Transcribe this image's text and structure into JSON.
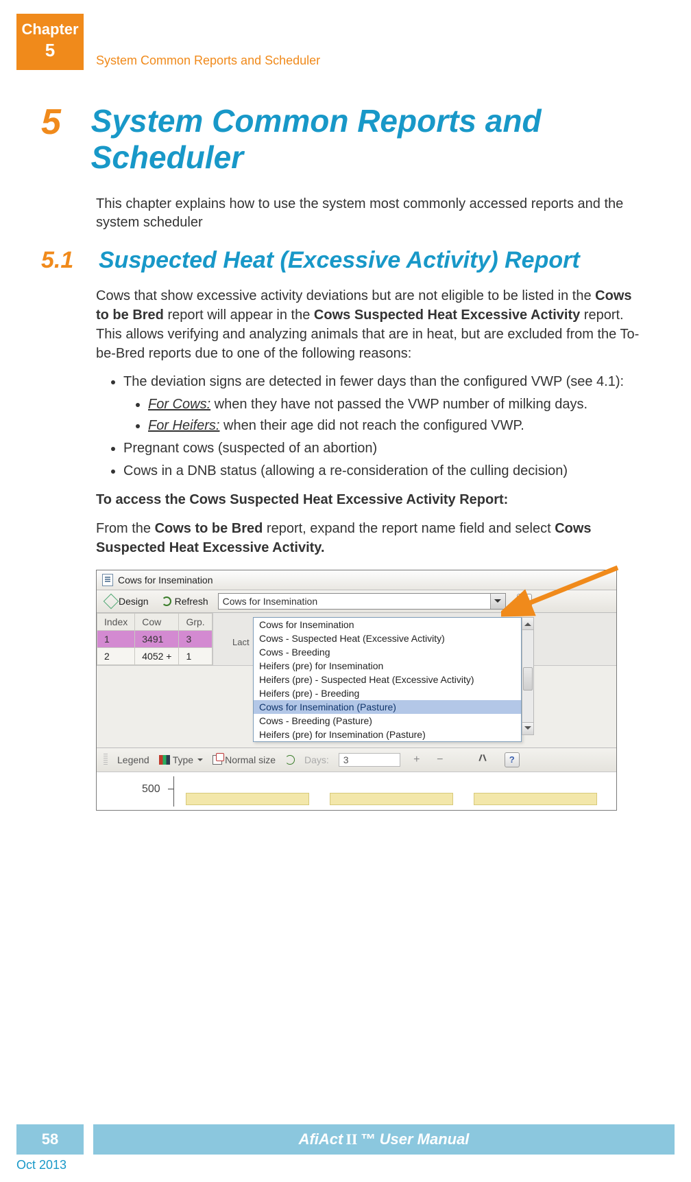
{
  "chapter_tab": {
    "word": "Chapter",
    "number": "5"
  },
  "running_head": "System Common Reports and Scheduler",
  "h1": {
    "num": "5",
    "title": "System Common Reports and Scheduler"
  },
  "intro": "This chapter explains how to use the system most commonly accessed reports and the system scheduler",
  "h2": {
    "num": "5.1",
    "title": "Suspected Heat (Excessive Activity) Report"
  },
  "para1_a": "Cows that show excessive activity deviations but are not eligible to be listed in the ",
  "para1_b": "Cows to be Bred",
  "para1_c": " report will appear in the ",
  "para1_d": "Cows Suspected Heat Excessive Activity",
  "para1_e": " report. This allows verifying and analyzing animals that are in heat, but are excluded from the To-be-Bred reports due to one of the following reasons:",
  "bullets": {
    "b1": "The deviation signs are detected in fewer days than the configured VWP (see 4.1):",
    "b1s1_lbl": "For Cows:",
    "b1s1_txt": " when they have not passed the VWP number of milking days.",
    "b1s2_lbl": "For Heifers:",
    "b1s2_txt": " when their age did not reach the configured VWP.",
    "b2": "Pregnant cows (suspected of an abortion)",
    "b3": "Cows in a DNB status (allowing a re-consideration of the culling decision)"
  },
  "access_head": "To access the Cows Suspected Heat Excessive Activity Report:",
  "access_a": "From the ",
  "access_b": "Cows to be Bred",
  "access_c": " report, expand the report name field and select ",
  "access_d": "Cows Suspected Heat Excessive Activity.",
  "app": {
    "window_title": "Cows for Insemination",
    "toolbar": {
      "design": "Design",
      "refresh": "Refresh",
      "help": "?"
    },
    "dropdown_selected": "Cows for Insemination",
    "dropdown_options": [
      "Cows for Insemination",
      "Cows - Suspected Heat (Excessive Activity)",
      "Cows - Breeding",
      "Heifers (pre) for Insemination",
      "Heifers (pre) - Suspected Heat (Excessive Activity)",
      "Heifers (pre) - Breeding",
      "Cows for Insemination (Pasture)",
      "Cows - Breeding (Pasture)",
      "Heifers (pre) for Insemination (Pasture)"
    ],
    "dropdown_selected_index": 6,
    "columns": {
      "c0": "Index",
      "c1": "Cow",
      "c2": "Grp.",
      "c3": "Lact"
    },
    "rows": [
      {
        "index": "1",
        "cow": "3491",
        "grp": "3"
      },
      {
        "index": "2",
        "cow": "4052 +",
        "grp": "1"
      }
    ],
    "bottom": {
      "legend": "Legend",
      "type": "Type",
      "normal_size": "Normal size",
      "days_label": "Days:",
      "days_value": "3",
      "plus": "+",
      "minus": "−"
    },
    "chart": {
      "ytick": "500"
    }
  },
  "footer": {
    "page": "58",
    "title_a": "AfiAct ",
    "title_b": "II",
    "title_c": "™ User Manual",
    "date": "Oct 2013"
  }
}
